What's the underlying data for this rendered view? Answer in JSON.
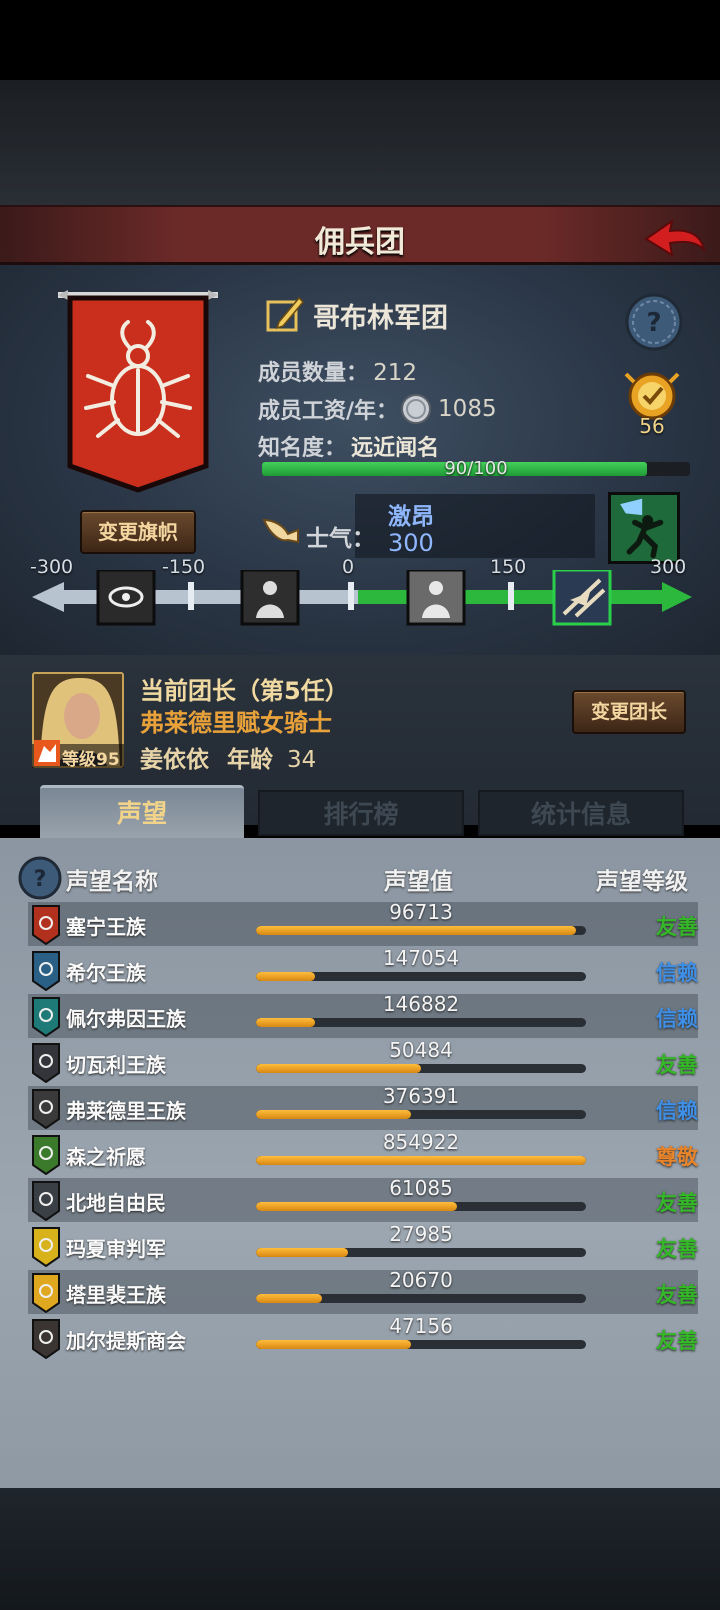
{
  "header": {
    "title": "佣兵团"
  },
  "guild": {
    "name": "哥布林军团",
    "member_count_label": "成员数量：",
    "member_count": "212",
    "salary_label": "成员工资/年：",
    "salary": "1085",
    "fame_label": "知名度：",
    "fame_title": "远近闻名",
    "fame_progress_text": "90/100",
    "fame_progress": 0.9,
    "medal_value": "56",
    "change_flag_button": "变更旗帜",
    "flag_icon": "stag-beetle-icon"
  },
  "morale": {
    "label": "士气：",
    "state": "激昂",
    "value": "300",
    "ticks": [
      "-300",
      "-150",
      "0",
      "150",
      "300"
    ],
    "min": -300,
    "max": 300,
    "current": 300
  },
  "leader": {
    "title": "当前团长（第5任）",
    "name": "弗莱德里赋女骑士",
    "person": "姜依依",
    "age_label": "年龄",
    "age": "34",
    "level_label": "等级95",
    "change_button": "变更团长"
  },
  "tabs": [
    {
      "label": "声望",
      "active": true
    },
    {
      "label": "排行榜",
      "active": false
    },
    {
      "label": "统计信息",
      "active": false
    }
  ],
  "reputation": {
    "headers": {
      "name": "声望名称",
      "value": "声望值",
      "level": "声望等级"
    },
    "rows": [
      {
        "name": "塞宁王族",
        "value": "96713",
        "progress": 0.97,
        "level": "友善",
        "level_color": "#35b828",
        "emblem_color": "#b2301e"
      },
      {
        "name": "希尔王族",
        "value": "147054",
        "progress": 0.18,
        "level": "信赖",
        "level_color": "#3d8fe8",
        "emblem_color": "#2a5f86"
      },
      {
        "name": "佩尔弗因王族",
        "value": "146882",
        "progress": 0.18,
        "level": "信赖",
        "level_color": "#3d8fe8",
        "emblem_color": "#1d7a76"
      },
      {
        "name": "切瓦利王族",
        "value": "50484",
        "progress": 0.5,
        "level": "友善",
        "level_color": "#35b828",
        "emblem_color": "#33353a"
      },
      {
        "name": "弗莱德里王族",
        "value": "376391",
        "progress": 0.47,
        "level": "信赖",
        "level_color": "#3d8fe8",
        "emblem_color": "#3b3a3a"
      },
      {
        "name": "森之祈愿",
        "value": "854922",
        "progress": 1.0,
        "level": "尊敬",
        "level_color": "#e8842a",
        "emblem_color": "#3b7a2a"
      },
      {
        "name": "北地自由民",
        "value": "61085",
        "progress": 0.61,
        "level": "友善",
        "level_color": "#35b828",
        "emblem_color": "#3a3f46"
      },
      {
        "name": "玛夏审判军",
        "value": "27985",
        "progress": 0.28,
        "level": "友善",
        "level_color": "#35b828",
        "emblem_color": "#d8b21a"
      },
      {
        "name": "塔里裴王族",
        "value": "20670",
        "progress": 0.2,
        "level": "友善",
        "level_color": "#35b828",
        "emblem_color": "#e0a81e"
      },
      {
        "name": "加尔提斯商会",
        "value": "47156",
        "progress": 0.47,
        "level": "友善",
        "level_color": "#35b828",
        "emblem_color": "#3a3532"
      }
    ]
  }
}
